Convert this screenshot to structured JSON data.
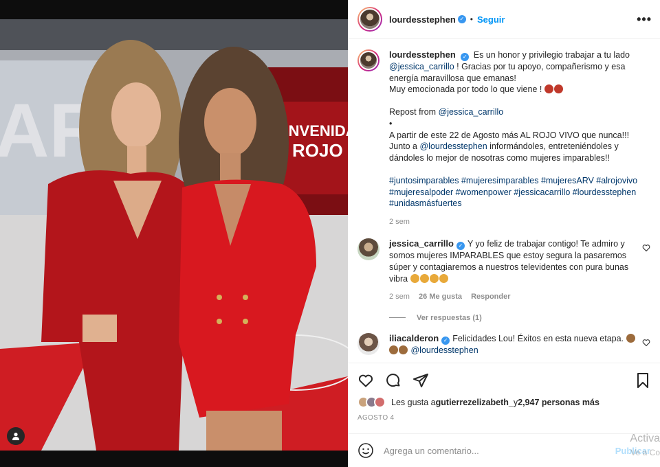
{
  "post": {
    "author": "lourdesstephen",
    "follow_label": "Seguir",
    "more_label": "•••",
    "caption_username": "lourdesstephen",
    "caption_lines": [
      "Es un honor y privilegio trabajar a tu lado",
      "@jessica_carrillo",
      " ! Gracias por tu apoyo, compañerismo y esa",
      "energía maravillosa que emanas!",
      "Muy emocionada por todo lo que viene ! "
    ],
    "repost_prefix": "Repost from ",
    "repost_user": "@jessica_carrillo",
    "bullet": "•",
    "body_line1": "A partir de este 22 de Agosto más AL ROJO VIVO que nunca!!!",
    "body_line2_prefix": "Junto a ",
    "body_line2_user": "@lourdesstephen",
    "body_line2_suffix": " informándoles, entreteniéndoles y",
    "body_line3": "dándoles lo mejor de nosotras como mujeres imparables!!",
    "hashtags": "#juntosimparables #mujeresimparables #mujeresARV #alrojovivo #mujeresalpoder #womenpower #jessicacarrillo #lourdesstephen #unidasmásfuertes",
    "time": "2 sem"
  },
  "comments": [
    {
      "username": "jessica_carrillo",
      "text": "Y yo feliz de trabajar contigo! Te admiro y somos mujeres IMPARABLES que estoy segura la pasaremos súper y contagiaremos a nuestros televidentes con pura bunas vibra ",
      "time": "2 sem",
      "likes": "26 Me gusta",
      "reply_label": "Responder",
      "view_replies": "Ver respuestas (1)"
    },
    {
      "username": "ilia​calderon",
      "text": "Felicidades Lou! Éxitos en esta nueva etapa. ",
      "mention": "@lourdesstephen"
    }
  ],
  "likes": {
    "prefix": "Les gusta a ",
    "user": "gutierrezelizabeth_",
    "middle": " y ",
    "count": "2,947 personas más"
  },
  "date": "AGOSTO 4",
  "add_comment": {
    "placeholder": "Agrega un comentario...",
    "publish_label": "Publicar"
  },
  "watermark": {
    "line1": "Activa",
    "line2": "Ve a Co"
  },
  "icons": [
    "heart-icon",
    "comment-icon",
    "share-icon",
    "bookmark-icon",
    "emoji-icon",
    "user-tag-icon",
    "more-icon",
    "verified-icon"
  ],
  "colors": {
    "link": "#00376b",
    "accent": "#0095f6",
    "verified": "#3897f0",
    "red_dress": "#c8171e"
  }
}
